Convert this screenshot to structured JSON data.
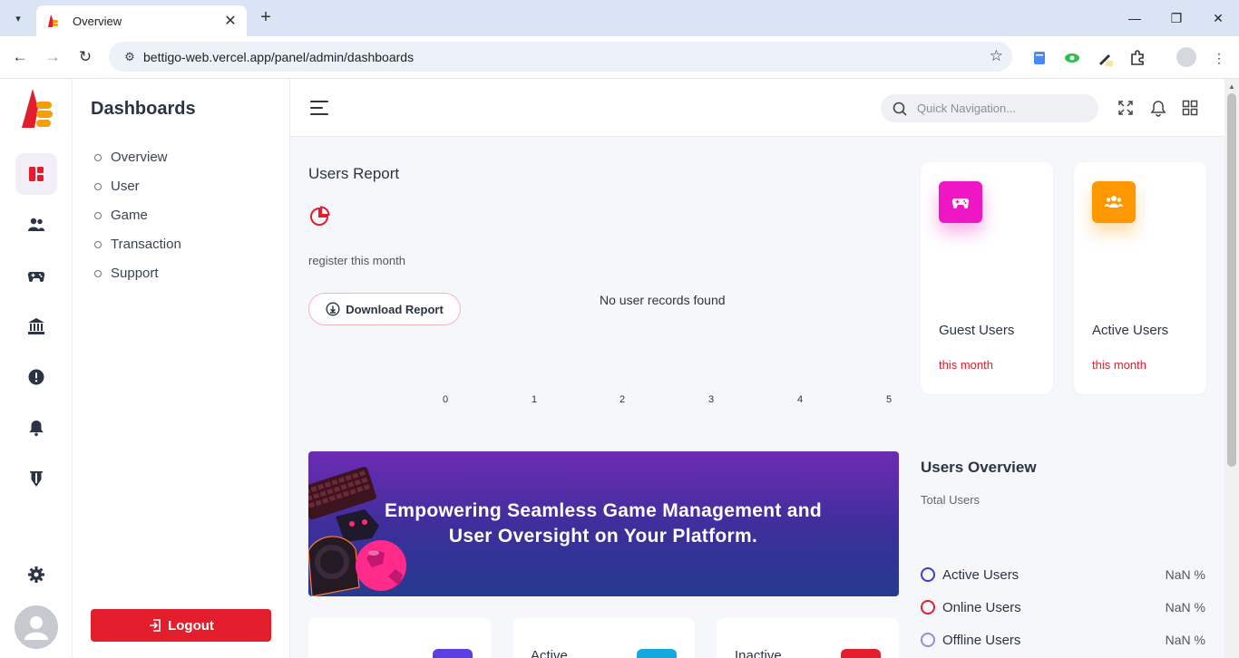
{
  "browser": {
    "tab_title": "Overview",
    "url": "bettigo-web.vercel.app/panel/admin/dashboards"
  },
  "sidebar": {
    "title": "Dashboards",
    "items": [
      {
        "label": "Overview"
      },
      {
        "label": "User"
      },
      {
        "label": "Game"
      },
      {
        "label": "Transaction"
      },
      {
        "label": "Support"
      }
    ],
    "logout_label": "Logout"
  },
  "rail": {
    "icons": [
      "dashboard-icon",
      "users-icon",
      "gamepad-icon",
      "bank-icon",
      "alert-icon",
      "bell-icon",
      "shield-icon",
      "settings-icon"
    ]
  },
  "topbar": {
    "search_placeholder": "Quick Navigation..."
  },
  "users_report": {
    "title": "Users Report",
    "subtitle": "register this month",
    "download_label": "Download Report",
    "empty_message": "No user records found",
    "x_ticks": [
      "0",
      "1",
      "2",
      "3",
      "4",
      "5"
    ]
  },
  "stat_cards": [
    {
      "label": "Guest Users",
      "sub": "this month",
      "color": "#ef16c3"
    },
    {
      "label": "Active Users",
      "sub": "this month",
      "color": "#ff9800"
    }
  ],
  "banner": {
    "text": "Empowering Seamless Game Management and User Oversight on Your Platform."
  },
  "users_overview": {
    "title": "Users Overview",
    "subtitle": "Total Users",
    "rows": [
      {
        "label": "Active Users",
        "value": "NaN %",
        "color": "#3b3fc8"
      },
      {
        "label": "Online Users",
        "value": "NaN %",
        "color": "#e21e2c"
      },
      {
        "label": "Offline Users",
        "value": "NaN %",
        "color": "#8b8fe0"
      }
    ]
  },
  "mini_cards": [
    {
      "label": "",
      "color": "#5b3fe0"
    },
    {
      "label": "Active",
      "color": "#13a8e0"
    },
    {
      "label": "Inactive",
      "color": "#e21e2c"
    }
  ],
  "colors": {
    "accent": "#e21e2c",
    "active_rail": "#f1eef8"
  }
}
